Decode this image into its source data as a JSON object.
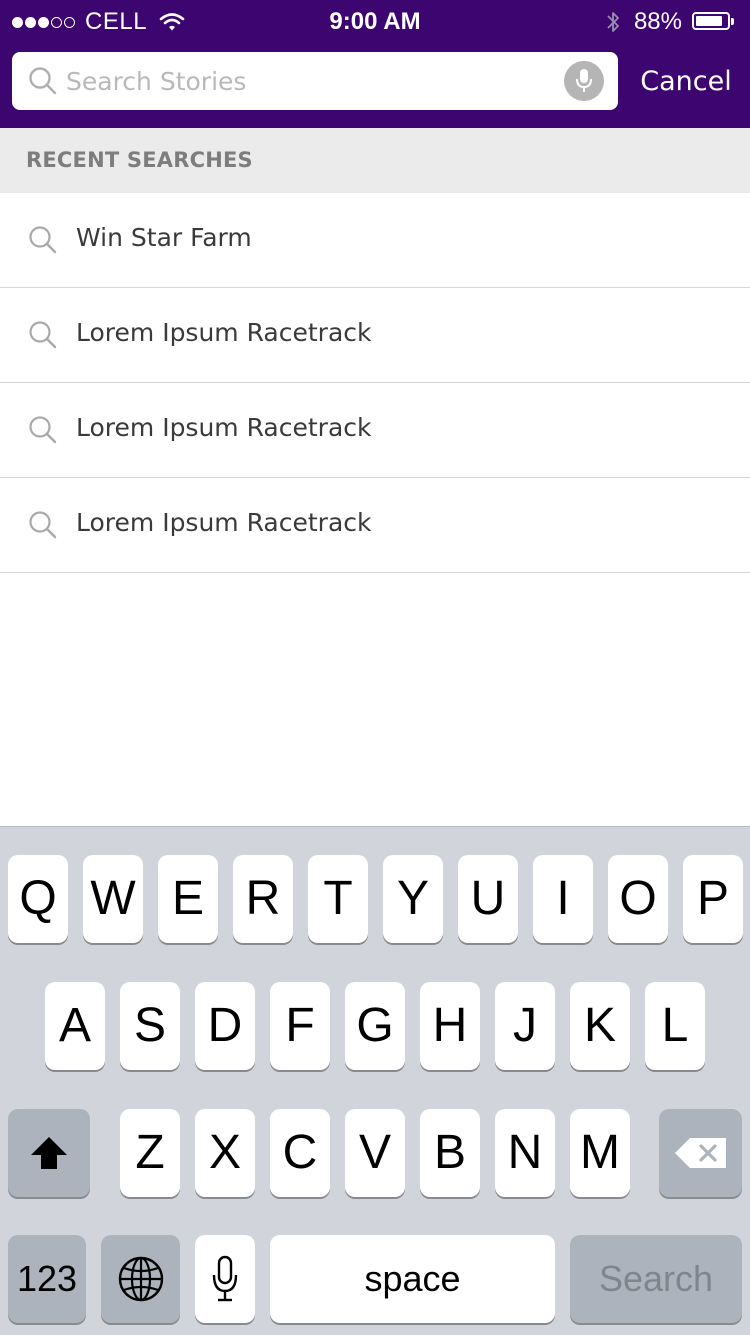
{
  "status_bar": {
    "carrier": "CELL",
    "time": "9:00 AM",
    "battery": "88%",
    "battery_level": 0.88,
    "signal_bars_filled": 3,
    "signal_bars_total": 5
  },
  "search": {
    "placeholder": "Search Stories",
    "value": "",
    "cancel_label": "Cancel"
  },
  "recent": {
    "title": "RECENT SEARCHES",
    "items": [
      {
        "label": "Win Star Farm"
      },
      {
        "label": "Lorem Ipsum Racetrack"
      },
      {
        "label": "Lorem Ipsum Racetrack"
      },
      {
        "label": "Lorem Ipsum Racetrack"
      }
    ]
  },
  "keyboard": {
    "row1": [
      "Q",
      "W",
      "E",
      "R",
      "T",
      "Y",
      "U",
      "I",
      "O",
      "P"
    ],
    "row2": [
      "A",
      "S",
      "D",
      "F",
      "G",
      "H",
      "J",
      "K",
      "L"
    ],
    "row3": [
      "Z",
      "X",
      "C",
      "V",
      "B",
      "N",
      "M"
    ],
    "numbers_label": "123",
    "space_label": "space",
    "return_label": "Search"
  },
  "colors": {
    "header_bg": "#3d0570",
    "section_bg": "#ebebeb",
    "keyboard_bg": "#d1d5db"
  }
}
